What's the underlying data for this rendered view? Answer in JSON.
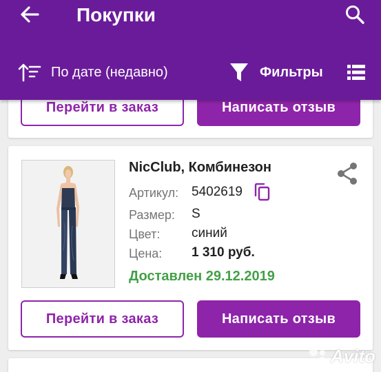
{
  "appbar": {
    "title": "Покупки",
    "back_icon": "arrow-back-icon",
    "search_icon": "search-icon",
    "background": "#6a1b9a"
  },
  "toolbar": {
    "sort_label": "По дате (недавно)",
    "sort_icon": "sort-icon",
    "filter_label": "Фильтры",
    "filter_icon": "filter-icon",
    "view_icon": "list-view-icon"
  },
  "orders": [
    {
      "go_to_order_label": "Перейти в заказ",
      "write_review_label": "Написать отзыв"
    },
    {
      "title": "NicClub, Комбинезон",
      "article_label": "Артикул:",
      "article": "5402619",
      "size_label": "Размер:",
      "size": "S",
      "color_label": "Цвет:",
      "color": "синий",
      "price_label": "Цена:",
      "price": "1 310 руб.",
      "status": "Доставлен 29.12.2019",
      "share_icon": "share-icon",
      "copy_icon": "copy-icon",
      "go_to_order_label": "Перейти в заказ",
      "write_review_label": "Написать отзыв"
    }
  ],
  "colors": {
    "accent": "#8e24aa",
    "delivered": "#43a047"
  },
  "watermark": {
    "text": "Avito",
    "icon": "avito-logo-icon"
  }
}
